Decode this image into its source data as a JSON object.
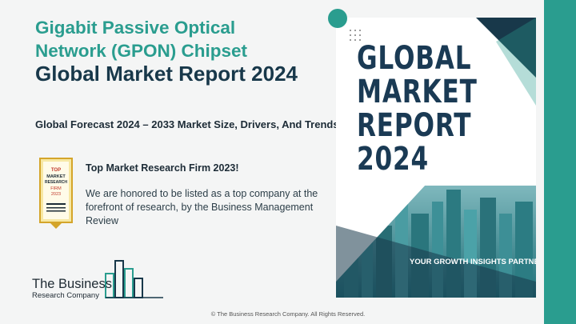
{
  "title": {
    "line1": "Gigabit Passive Optical Network (GPON) Chipset",
    "line2": "Global Market Report 2024"
  },
  "subtitle": "Global Forecast 2024 – 2033 Market Size, Drivers, And Trends",
  "award": {
    "heading": "Top Market Research Firm 2023!",
    "text": "We are honored to be listed as a top company at the forefront of research, by the Business Management Review",
    "badge_lines": [
      "TOP",
      "MARKET",
      "RESEARCH",
      "FIRM",
      "2023"
    ]
  },
  "logo": {
    "name": "The Business",
    "sub": "Research Company"
  },
  "cover": {
    "title_lines": [
      "GLOBAL",
      "MARKET",
      "REPORT",
      "2024"
    ],
    "tagline": "YOUR GROWTH INSIGHTS PARTNER"
  },
  "footer": "© The Business Research Company. All Rights Reserved.",
  "colors": {
    "accent": "#2a9d8f",
    "dark_text": "#18384a",
    "background": "#f4f5f5"
  }
}
